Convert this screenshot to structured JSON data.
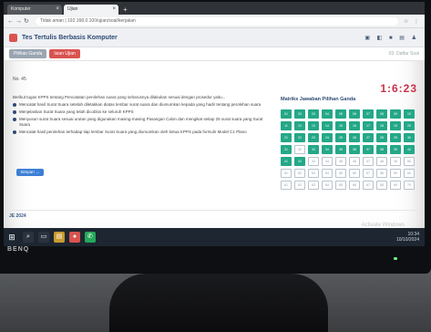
{
  "browser": {
    "tabs": [
      {
        "label": "Komputer"
      },
      {
        "label": "Ujian"
      }
    ],
    "url": "Tidak aman | 192.168.0.100/ujian/soal/kerjakan"
  },
  "app": {
    "title": "Tes Tertulis Berbasis Komputer",
    "tabs": [
      {
        "label": "Pilihan Ganda"
      },
      {
        "label": "Isian Ujian"
      }
    ],
    "daftar_label": "03. Daftar Soal"
  },
  "question": {
    "number_label": "No. 45",
    "timer": "1:6:23",
    "prompt": "Berikut tugas KPPS tentang Pencatatan perolehan suara yang seharusnya dilakukan sesuai dengan prosedur yaitu...",
    "options": [
      "Mencatat hasil Surat Suara setelah diletakkan diatas lembar surat suara dan diumumkan kepada yang hadir tentang perolehan suara",
      "Menjelaskan Surat Suara yang telah dicoblos ke seluruh KPPS",
      "Menyusun surat Suara sesuai urutan yang digunakan masing-masing Pasangan Calon dan mengikat setiap 25 surat suara yang Surat Suara",
      "Mencatat hasil perolehan terhadap tiap lembar Surat Suara yang diumumkan oleh ketua KPPS pada formulir Model C1 Plano"
    ],
    "next_button": "Simpan →"
  },
  "answer_grid": {
    "title": "Matriks Jawaban Pilihan Ganda",
    "cells": [
      {
        "n": "01",
        "done": true
      },
      {
        "n": "02",
        "done": true
      },
      {
        "n": "03",
        "done": true
      },
      {
        "n": "04",
        "done": true
      },
      {
        "n": "05",
        "done": true
      },
      {
        "n": "06",
        "done": true
      },
      {
        "n": "07",
        "done": true
      },
      {
        "n": "08",
        "done": true
      },
      {
        "n": "09",
        "done": true
      },
      {
        "n": "10",
        "done": true
      },
      {
        "n": "11",
        "done": true
      },
      {
        "n": "12",
        "done": true
      },
      {
        "n": "13",
        "done": true
      },
      {
        "n": "14",
        "done": true
      },
      {
        "n": "15",
        "done": true
      },
      {
        "n": "16",
        "done": true
      },
      {
        "n": "17",
        "done": true
      },
      {
        "n": "18",
        "done": true
      },
      {
        "n": "19",
        "done": true
      },
      {
        "n": "20",
        "done": true
      },
      {
        "n": "21",
        "done": true
      },
      {
        "n": "22",
        "done": true
      },
      {
        "n": "23",
        "done": true
      },
      {
        "n": "24",
        "done": true
      },
      {
        "n": "25",
        "done": true
      },
      {
        "n": "26",
        "done": true
      },
      {
        "n": "27",
        "done": true
      },
      {
        "n": "28",
        "done": true
      },
      {
        "n": "29",
        "done": true
      },
      {
        "n": "30",
        "done": true
      },
      {
        "n": "31",
        "done": true
      },
      {
        "n": "32",
        "done": false
      },
      {
        "n": "33",
        "done": true
      },
      {
        "n": "34",
        "done": true
      },
      {
        "n": "35",
        "done": true
      },
      {
        "n": "36",
        "done": true
      },
      {
        "n": "37",
        "done": true
      },
      {
        "n": "38",
        "done": true
      },
      {
        "n": "39",
        "done": true
      },
      {
        "n": "40",
        "done": true
      },
      {
        "n": "41",
        "done": true
      },
      {
        "n": "42",
        "done": true
      },
      {
        "n": "43",
        "done": false
      },
      {
        "n": "44",
        "done": false
      },
      {
        "n": "45",
        "done": false
      },
      {
        "n": "46",
        "done": false
      },
      {
        "n": "47",
        "done": false
      },
      {
        "n": "48",
        "done": false
      },
      {
        "n": "49",
        "done": false
      },
      {
        "n": "50",
        "done": false
      },
      {
        "n": "51",
        "done": false
      },
      {
        "n": "52",
        "done": false
      },
      {
        "n": "53",
        "done": false
      },
      {
        "n": "54",
        "done": false
      },
      {
        "n": "55",
        "done": false
      },
      {
        "n": "56",
        "done": false
      },
      {
        "n": "57",
        "done": false
      },
      {
        "n": "58",
        "done": false
      },
      {
        "n": "59",
        "done": false
      },
      {
        "n": "60",
        "done": false
      },
      {
        "n": "61",
        "done": false
      },
      {
        "n": "62",
        "done": false
      },
      {
        "n": "63",
        "done": false
      },
      {
        "n": "64",
        "done": false
      },
      {
        "n": "65",
        "done": false
      },
      {
        "n": "66",
        "done": false
      },
      {
        "n": "67",
        "done": false
      },
      {
        "n": "68",
        "done": false
      },
      {
        "n": "69",
        "done": false
      },
      {
        "n": "70",
        "done": false
      }
    ]
  },
  "footer": {
    "brand_link": "JE 2024",
    "watermark": "Activate Windows"
  },
  "taskbar": {
    "time": "10:34",
    "date": "10/10/2024"
  },
  "monitor": {
    "brand": "BENQ"
  },
  "colors": {
    "accent": "#2d4a73",
    "timer": "#c9304a",
    "answered": "#24a887",
    "red_tab": "#d9534f",
    "button": "#3d7fd6"
  }
}
